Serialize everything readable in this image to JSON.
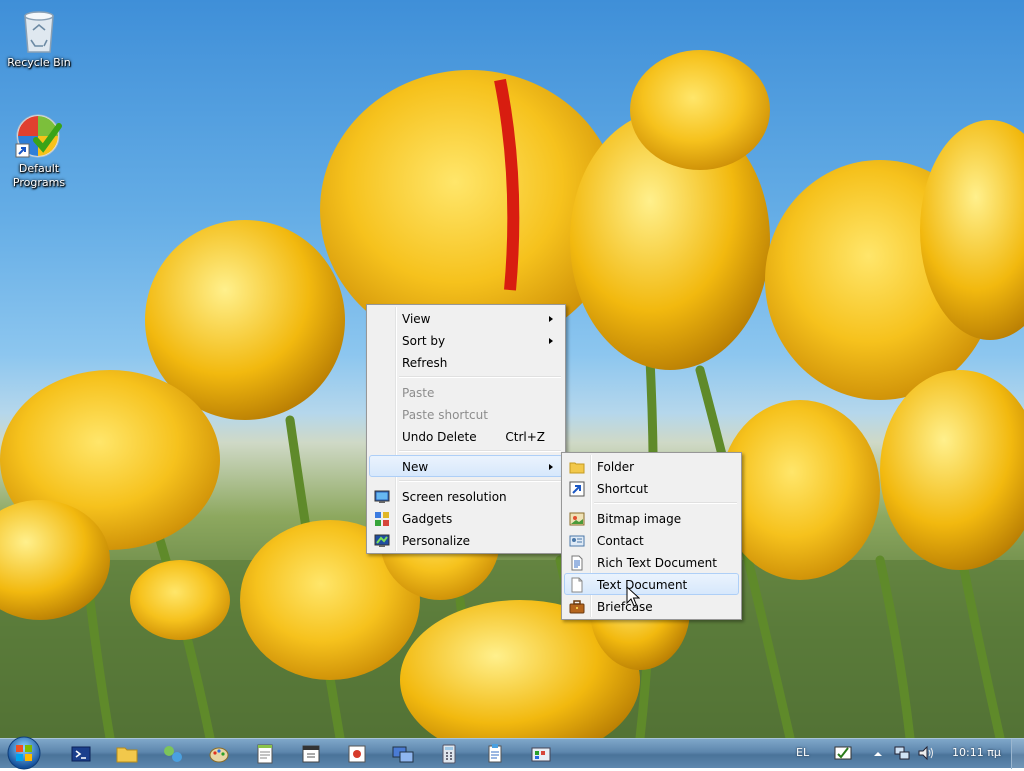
{
  "desktop": {
    "icons": [
      {
        "label": "Recycle Bin",
        "icon": "recycle-bin-icon"
      },
      {
        "label": "Default\nPrograms",
        "label_line1": "Default",
        "label_line2": "Programs",
        "icon": "default-programs-icon"
      }
    ]
  },
  "context_menu": {
    "items": [
      {
        "label": "View",
        "submenu": true
      },
      {
        "label": "Sort by",
        "submenu": true
      },
      {
        "label": "Refresh"
      },
      {
        "label": "Paste",
        "disabled": true
      },
      {
        "label": "Paste shortcut",
        "disabled": true
      },
      {
        "label": "Undo Delete",
        "shortcut": "Ctrl+Z"
      },
      {
        "label": "New",
        "submenu": true,
        "highlighted": true
      },
      {
        "label": "Screen resolution",
        "icon": "monitor-icon"
      },
      {
        "label": "Gadgets",
        "icon": "gadgets-icon"
      },
      {
        "label": "Personalize",
        "icon": "personalize-icon"
      }
    ]
  },
  "new_submenu": {
    "items": [
      {
        "label": "Folder",
        "icon": "folder-icon"
      },
      {
        "label": "Shortcut",
        "icon": "shortcut-icon"
      },
      {
        "label": "Bitmap image",
        "icon": "bitmap-icon"
      },
      {
        "label": "Contact",
        "icon": "contact-icon"
      },
      {
        "label": "Rich Text Document",
        "icon": "rich-text-icon"
      },
      {
        "label": "Text Document",
        "icon": "text-document-icon",
        "highlighted": true
      },
      {
        "label": "Briefcase",
        "icon": "briefcase-icon"
      }
    ]
  },
  "taskbar": {
    "pinned": [
      "powershell-icon",
      "explorer-icon",
      "network-icon",
      "paint-icon",
      "notepad-icon",
      "calendar-icon",
      "media-icon",
      "remote-desktop-icon",
      "calculator-icon",
      "wordpad-icon",
      "control-panel-icon"
    ],
    "language": "EL",
    "clock": "10:11 πμ",
    "colors": {
      "accent": "#5d86ad"
    }
  }
}
